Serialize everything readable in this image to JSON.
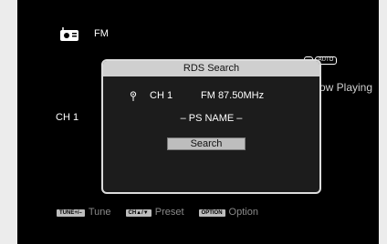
{
  "header": {
    "band": "FM"
  },
  "badges": [
    "AUTO"
  ],
  "background_text": {
    "now_playing": "ow Playing",
    "channel": "CH 1"
  },
  "dialog": {
    "title": "RDS Search",
    "channel": "CH 1",
    "frequency": "FM 87.50MHz",
    "ps_name": "– PS NAME –",
    "search_label": "Search"
  },
  "footer": {
    "hints": [
      {
        "key": "TUNE+/–",
        "label": "Tune"
      },
      {
        "key": "CH▲/▼",
        "label": "Preset"
      },
      {
        "key": "OPTION",
        "label": "Option"
      }
    ]
  }
}
